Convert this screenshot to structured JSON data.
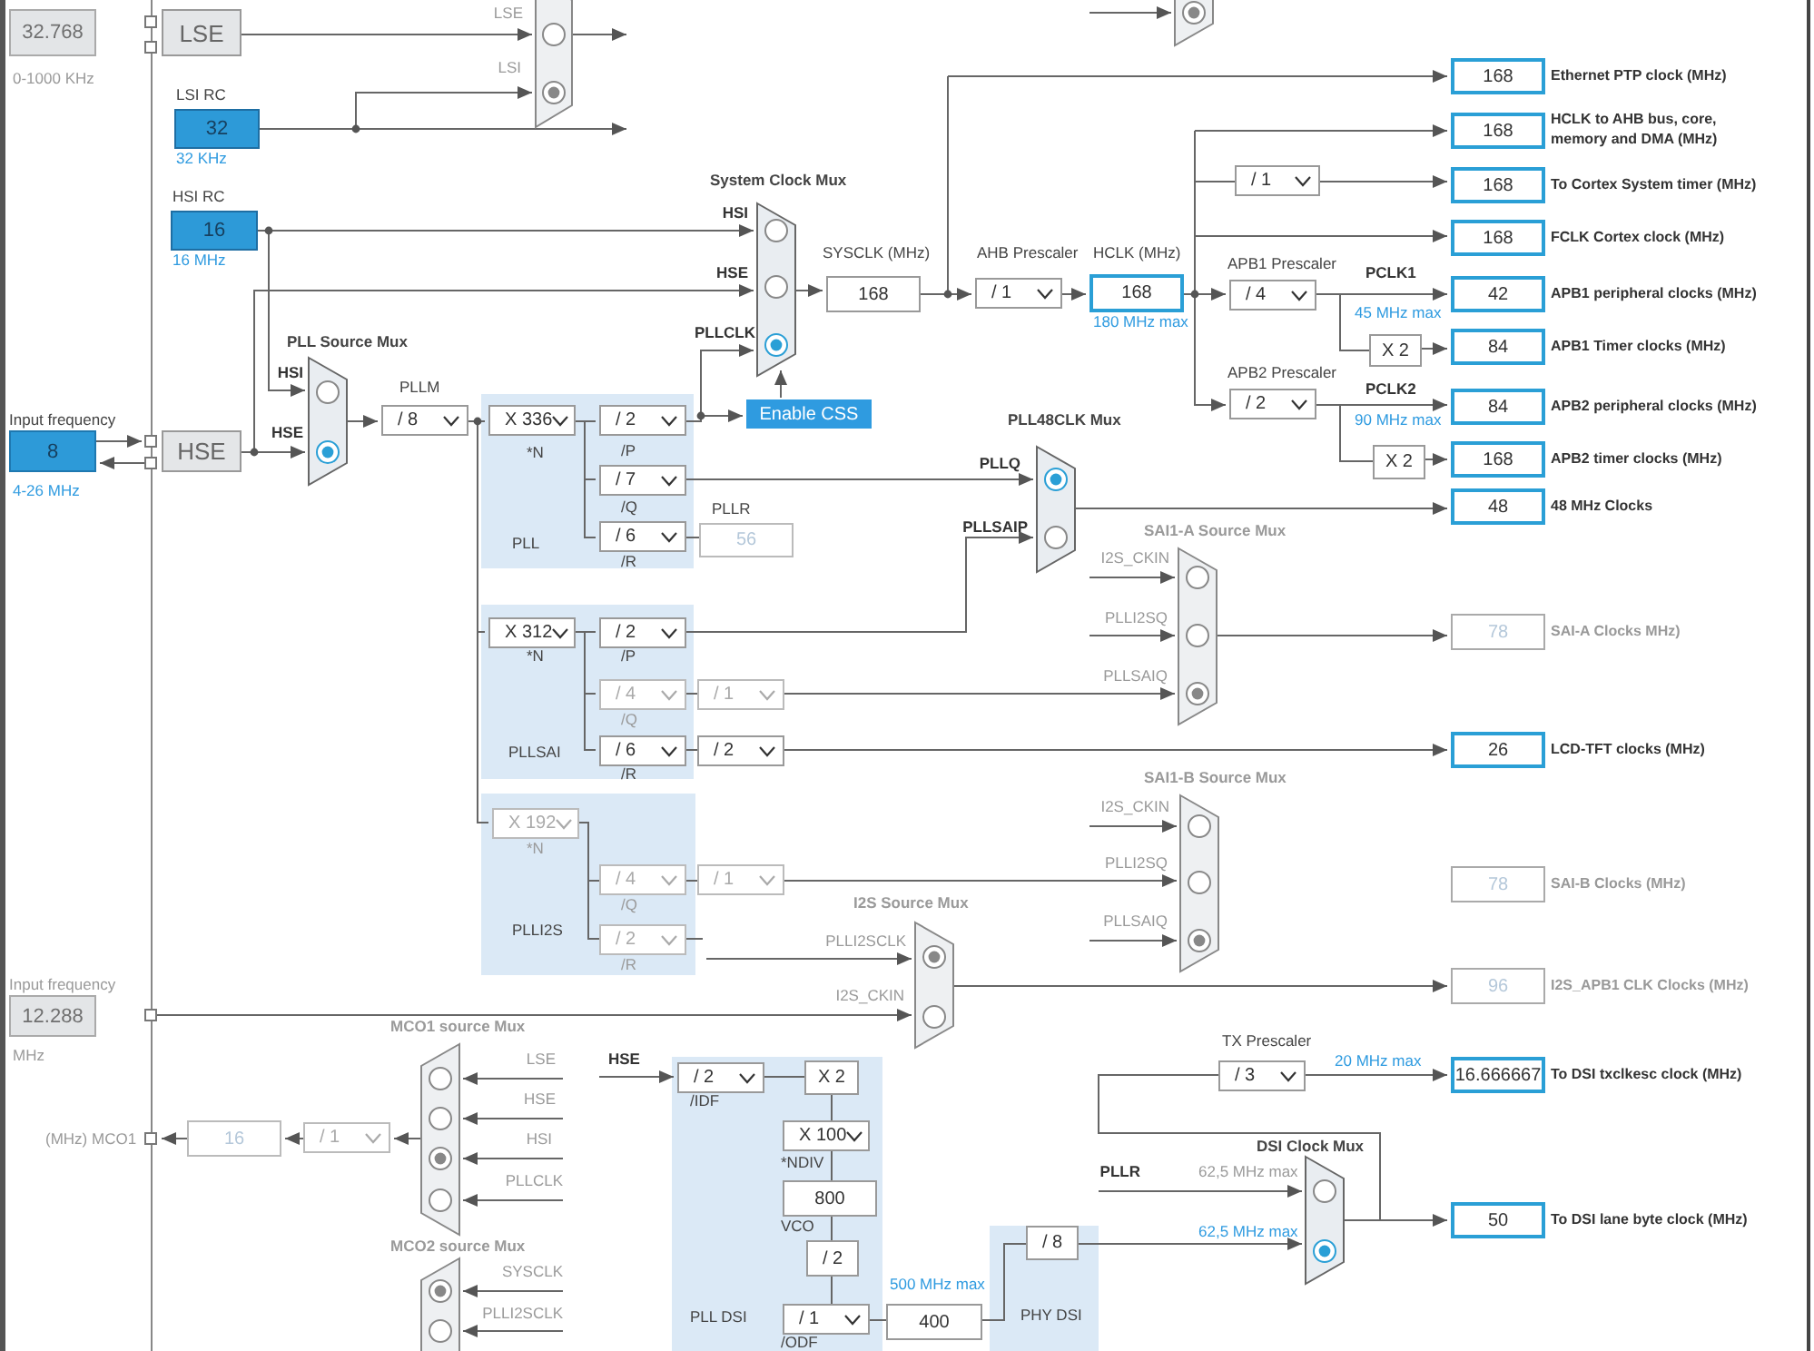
{
  "input_frequencies": [
    {
      "value": "32.768",
      "range": "0-1000 KHz",
      "enabled": false
    },
    {
      "label": "Input frequency",
      "value": "8",
      "range": "4-26 MHz",
      "enabled": true
    },
    {
      "label": "Input frequency",
      "value": "12.288",
      "range": "MHz",
      "enabled": false
    }
  ],
  "oscillators": [
    {
      "kind": "external",
      "name": "LSE"
    },
    {
      "kind": "rc",
      "name": "LSI RC",
      "value": "32",
      "note": "32 KHz"
    },
    {
      "kind": "rc",
      "name": "HSI RC",
      "value": "16",
      "note": "16 MHz"
    },
    {
      "kind": "external",
      "name": "HSE"
    }
  ],
  "muxes": [
    {
      "enabled": false,
      "inputs": [
        {
          "label": "LSE",
          "selected": false
        },
        {
          "label": "LSI",
          "selected": true
        }
      ]
    },
    {
      "enabled": false,
      "inputs": [
        {
          "selected": true
        }
      ]
    },
    {
      "title": "System Clock Mux",
      "enabled": true,
      "inputs": [
        {
          "label": "HSI",
          "selected": false
        },
        {
          "label": "HSE",
          "selected": false
        },
        {
          "label": "PLLCLK",
          "selected": true
        }
      ]
    },
    {
      "title": "PLL Source Mux",
      "enabled": true,
      "inputs": [
        {
          "label": "HSI",
          "selected": false
        },
        {
          "label": "HSE",
          "selected": true
        }
      ]
    },
    {
      "title": "PLL48CLK Mux",
      "enabled": true,
      "inputs": [
        {
          "label": "PLLQ",
          "selected": true
        },
        {
          "label": "PLLSAIP",
          "selected": false
        }
      ]
    },
    {
      "title": "SAI1-A Source Mux",
      "enabled": false,
      "inputs": [
        {
          "label": "I2S_CKIN",
          "selected": false
        },
        {
          "label": "PLLI2SQ",
          "selected": false
        },
        {
          "label": "PLLSAIQ",
          "selected": true
        }
      ]
    },
    {
      "title": "SAI1-B Source Mux",
      "enabled": false,
      "inputs": [
        {
          "label": "I2S_CKIN",
          "selected": false
        },
        {
          "label": "PLLI2SQ",
          "selected": false
        },
        {
          "label": "PLLSAIQ",
          "selected": true
        }
      ]
    },
    {
      "title": "I2S Source Mux",
      "enabled": false,
      "inputs": [
        {
          "label": "PLLI2SCLK",
          "selected": true
        },
        {
          "label": "I2S_CKIN",
          "selected": false
        }
      ]
    },
    {
      "title": "MCO1 source Mux",
      "enabled": false,
      "inputs": [
        {
          "label": "LSE",
          "selected": false
        },
        {
          "label": "HSE",
          "selected": false
        },
        {
          "label": "HSI",
          "selected": true
        },
        {
          "label": "PLLCLK",
          "selected": false
        }
      ]
    },
    {
      "title": "MCO2 source Mux",
      "enabled": false,
      "inputs": [
        {
          "label": "SYSCLK",
          "selected": true
        },
        {
          "label": "PLLI2SCLK",
          "selected": false
        }
      ]
    },
    {
      "title": "DSI Clock Mux",
      "enabled": true,
      "inputs": [
        {
          "label": "PLLR",
          "selected": false
        },
        {
          "selected": true
        }
      ]
    }
  ],
  "blocks": [
    {
      "name": "PLL"
    },
    {
      "name": "PLLSAI"
    },
    {
      "name": "PLLI2S"
    },
    {
      "name": "PLL DSI"
    },
    {
      "name": "PHY DSI"
    }
  ],
  "dividers": [
    {
      "kind": "dropdown",
      "value": "/ 1",
      "enabled": true
    },
    {
      "kind": "dropdown",
      "value": "/ 1",
      "enabled": true
    },
    {
      "kind": "dropdown",
      "value": "/ 4",
      "enabled": true
    },
    {
      "kind": "fixed",
      "value": "X 2",
      "enabled": true
    },
    {
      "kind": "dropdown",
      "value": "/ 2",
      "enabled": true
    },
    {
      "kind": "fixed",
      "value": "X 2",
      "enabled": true
    },
    {
      "kind": "dropdown",
      "value": "/ 8",
      "enabled": true
    },
    {
      "kind": "dropdown",
      "value": "X 336",
      "caption": "*N",
      "enabled": true
    },
    {
      "kind": "dropdown",
      "value": "/ 2",
      "caption": "/P",
      "enabled": true
    },
    {
      "kind": "dropdown",
      "value": "/ 7",
      "caption": "/Q",
      "enabled": true
    },
    {
      "kind": "dropdown",
      "value": "/ 6",
      "caption": "/R",
      "enabled": true
    },
    {
      "kind": "dropdown",
      "value": "X 312",
      "caption": "*N",
      "enabled": true
    },
    {
      "kind": "dropdown",
      "value": "/ 2",
      "caption": "/P",
      "enabled": true
    },
    {
      "kind": "dropdown",
      "value": "/ 4",
      "caption": "/Q",
      "enabled": false
    },
    {
      "kind": "dropdown",
      "value": "/ 6",
      "caption": "/R",
      "enabled": true
    },
    {
      "kind": "dropdown",
      "value": "/ 1",
      "enabled": false
    },
    {
      "kind": "dropdown",
      "value": "/ 2",
      "enabled": true
    },
    {
      "kind": "dropdown",
      "value": "X 192",
      "caption": "*N",
      "enabled": false
    },
    {
      "kind": "dropdown",
      "value": "/ 4",
      "caption": "/Q",
      "enabled": false
    },
    {
      "kind": "dropdown",
      "value": "/ 2",
      "caption": "/R",
      "enabled": false
    },
    {
      "kind": "dropdown",
      "value": "/ 1",
      "enabled": false
    },
    {
      "kind": "dropdown",
      "value": "/ 1",
      "enabled": false
    },
    {
      "kind": "dropdown",
      "value": "/ 2",
      "caption": "/IDF",
      "enabled": true
    },
    {
      "kind": "fixed",
      "value": "X 2",
      "enabled": true
    },
    {
      "kind": "dropdown",
      "value": "X 100",
      "caption": "*NDIV",
      "enabled": true
    },
    {
      "kind": "fixed",
      "value": "/ 2",
      "enabled": true
    },
    {
      "kind": "dropdown",
      "value": "/ 1",
      "caption": "/ODF",
      "enabled": true
    },
    {
      "kind": "fixed",
      "value": "/ 8",
      "enabled": true
    },
    {
      "kind": "dropdown",
      "value": "/ 3",
      "enabled": true
    }
  ],
  "values": [
    {
      "value": "168",
      "enabled": true,
      "highlighted": false
    },
    {
      "value": "168",
      "enabled": true,
      "highlighted": true
    },
    {
      "value": "56",
      "enabled": false,
      "highlighted": false
    },
    {
      "value": "16",
      "enabled": false,
      "highlighted": false
    },
    {
      "value": "800",
      "enabled": true,
      "highlighted": false
    },
    {
      "value": "400",
      "enabled": true,
      "highlighted": false
    }
  ],
  "outputs": [
    {
      "value": "168",
      "label": "Ethernet PTP clock (MHz)",
      "enabled": true
    },
    {
      "value": "168",
      "label": "HCLK to AHB bus, core, memory and DMA (MHz)",
      "enabled": true
    },
    {
      "value": "168",
      "label": "To Cortex System timer (MHz)",
      "enabled": true
    },
    {
      "value": "168",
      "label": "FCLK Cortex clock (MHz)",
      "enabled": true
    },
    {
      "value": "42",
      "label": "APB1 peripheral clocks (MHz)",
      "enabled": true
    },
    {
      "value": "84",
      "label": "APB1 Timer clocks (MHz)",
      "enabled": true
    },
    {
      "value": "84",
      "label": "APB2 peripheral clocks (MHz)",
      "enabled": true
    },
    {
      "value": "168",
      "label": "APB2 timer clocks (MHz)",
      "enabled": true
    },
    {
      "value": "48",
      "label": "48 MHz Clocks",
      "enabled": true
    },
    {
      "value": "78",
      "label": "SAI-A Clocks MHz)",
      "enabled": false
    },
    {
      "value": "26",
      "label": "LCD-TFT clocks (MHz)",
      "enabled": true
    },
    {
      "value": "78",
      "label": "SAI-B Clocks (MHz)",
      "enabled": false
    },
    {
      "value": "96",
      "label": "I2S_APB1 CLK Clocks (MHz)",
      "enabled": false
    },
    {
      "value": "16.666667",
      "label": "To DSI txclkesc clock (MHz)",
      "enabled": true
    },
    {
      "value": "50",
      "label": "To DSI lane byte clock (MHz)",
      "enabled": true
    }
  ],
  "labels": [
    {
      "kind": "heading",
      "text": "SYSCLK (MHz)"
    },
    {
      "kind": "heading",
      "text": "AHB Prescaler"
    },
    {
      "kind": "heading",
      "text": "HCLK (MHz)"
    },
    {
      "kind": "note",
      "text": "180 MHz max"
    },
    {
      "kind": "heading",
      "text": "APB1 Prescaler"
    },
    {
      "kind": "signal",
      "text": "PCLK1"
    },
    {
      "kind": "note",
      "text": "45 MHz max"
    },
    {
      "kind": "heading",
      "text": "APB2 Prescaler"
    },
    {
      "kind": "signal",
      "text": "PCLK2"
    },
    {
      "kind": "note",
      "text": "90 MHz max"
    },
    {
      "kind": "heading",
      "text": "PLLM"
    },
    {
      "kind": "heading",
      "text": "PLLR"
    },
    {
      "kind": "heading",
      "text": "TX Prescaler"
    },
    {
      "kind": "note",
      "text": "20 MHz max"
    },
    {
      "kind": "caption",
      "text": "62,5 MHz max"
    },
    {
      "kind": "note",
      "text": "62,5 MHz max"
    },
    {
      "kind": "signal",
      "text": "HSE"
    },
    {
      "kind": "note",
      "text": "500 MHz max"
    },
    {
      "kind": "heading",
      "text": "VCO"
    },
    {
      "kind": "caption",
      "text": "(MHz) MCO1"
    }
  ],
  "enable_css_button": {
    "label": "Enable CSS"
  }
}
